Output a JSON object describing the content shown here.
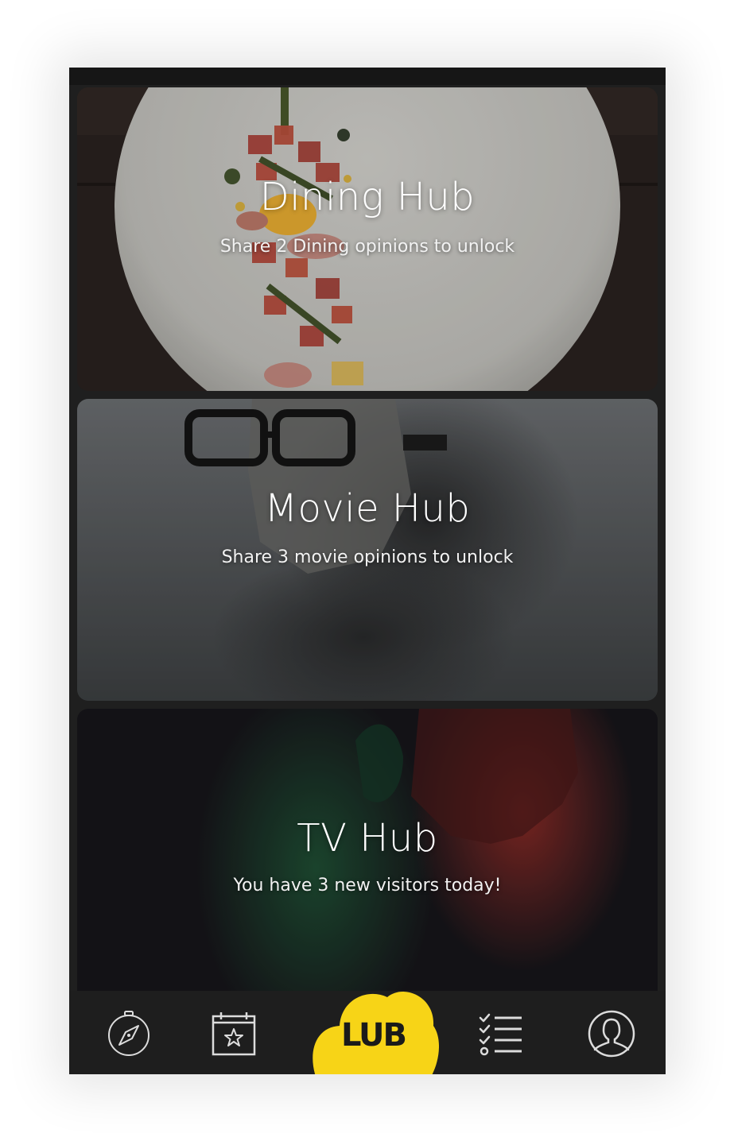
{
  "hubs": [
    {
      "title": "Dining Hub",
      "subtitle": "Share 2 Dining opinions to unlock"
    },
    {
      "title": "Movie Hub",
      "subtitle": "Share 3 movie opinions to unlock"
    },
    {
      "title": "TV Hub",
      "subtitle": "You have 3 new visitors today!"
    }
  ],
  "tabbar": {
    "items": [
      {
        "icon": "compass-icon"
      },
      {
        "icon": "calendar-star-icon"
      },
      {
        "icon": "home-cloud-logo",
        "logo_text": "LUB"
      },
      {
        "icon": "checklist-icon"
      },
      {
        "icon": "profile-icon"
      }
    ],
    "accent": "#f7d417"
  }
}
